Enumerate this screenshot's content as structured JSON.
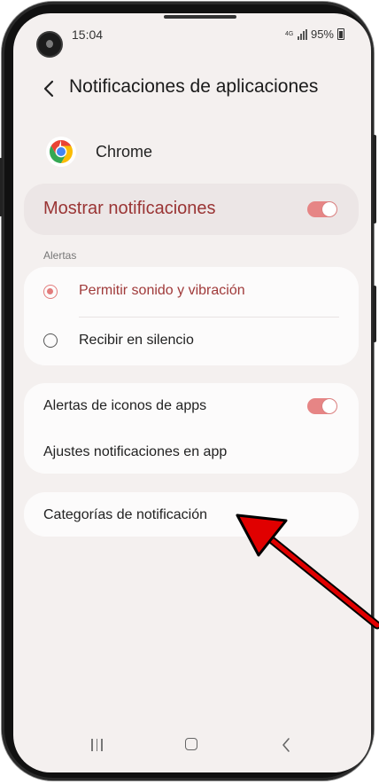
{
  "status_bar": {
    "time": "15:04",
    "network_label": "4G",
    "battery_text": "95%"
  },
  "header": {
    "title": "Notificaciones de aplicaciones"
  },
  "app": {
    "name": "Chrome"
  },
  "master": {
    "label": "Mostrar notificaciones",
    "enabled": true
  },
  "alerts": {
    "section_label": "Alertas",
    "options": [
      {
        "label": "Permitir sonido y vibración",
        "selected": true
      },
      {
        "label": "Recibir en silencio",
        "selected": false
      }
    ]
  },
  "settings": {
    "icon_badges_label": "Alertas de iconos de apps",
    "icon_badges_enabled": true,
    "in_app_label": "Ajustes notificaciones en app"
  },
  "categories": {
    "label": "Categorías de notificación"
  },
  "colors": {
    "accent": "#e68585",
    "accent_text": "#9a3434",
    "background": "#f4f0ef",
    "arrow": "#e00000"
  },
  "icons": {
    "back": "chevron-left-icon",
    "app": "chrome-icon",
    "nav_recent": "recent-apps-icon",
    "nav_home": "home-icon",
    "nav_back": "back-icon"
  }
}
